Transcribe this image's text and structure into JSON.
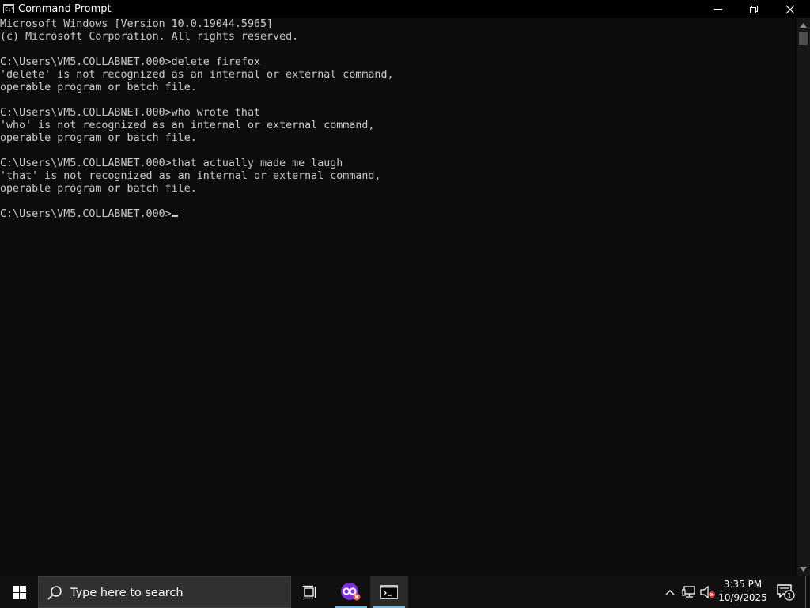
{
  "window": {
    "title": "Command Prompt",
    "icon_glyph": "C:\\"
  },
  "console": {
    "lines": [
      "Microsoft Windows [Version 10.0.19044.5965]",
      "(c) Microsoft Corporation. All rights reserved.",
      "",
      "C:\\Users\\VM5.COLLABNET.000>delete firefox",
      "'delete' is not recognized as an internal or external command,",
      "operable program or batch file.",
      "",
      "C:\\Users\\VM5.COLLABNET.000>who wrote that",
      "'who' is not recognized as an internal or external command,",
      "operable program or batch file.",
      "",
      "C:\\Users\\VM5.COLLABNET.000>that actually made me laugh",
      "'that' is not recognized as an internal or external command,",
      "operable program or batch file.",
      ""
    ],
    "prompt": "C:\\Users\\VM5.COLLABNET.000>"
  },
  "taskbar": {
    "search_placeholder": "Type here to search",
    "clock_time": "3:35 PM",
    "clock_date": "10/9/2025",
    "notification_count": "1"
  },
  "colors": {
    "console_bg": "#0c0c0c",
    "console_text": "#cccccc",
    "taskbar_bg": "#101010",
    "accent": "#76b9ed"
  },
  "icons": {
    "minimize": "minimize-icon",
    "maximize": "restore-icon",
    "close": "close-icon",
    "start": "windows-logo-icon",
    "search": "search-icon",
    "task_view": "task-view-icon",
    "meet": "meet-app-icon",
    "cmd": "cmd-app-icon",
    "chevron": "chevron-up-icon",
    "network": "network-icon",
    "volume": "volume-muted-icon",
    "notifications": "notifications-icon"
  }
}
